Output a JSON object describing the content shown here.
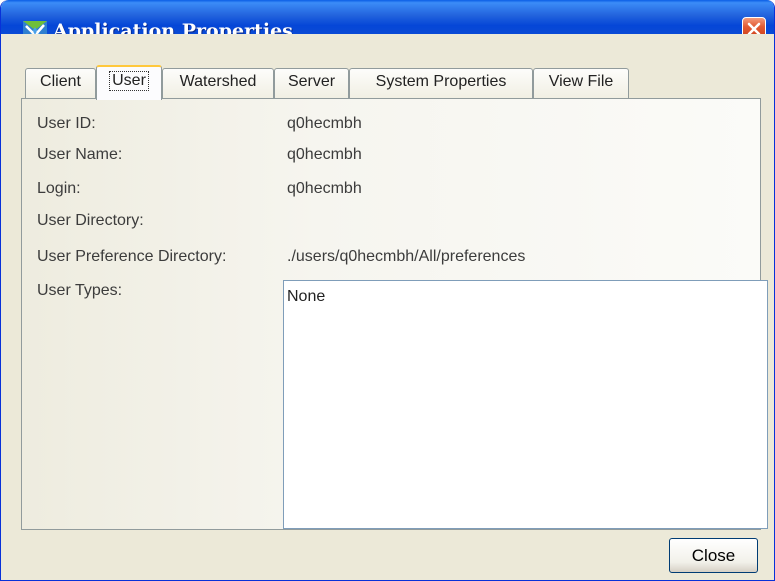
{
  "window": {
    "title": "Application Properties"
  },
  "tabs": [
    {
      "label": "Client"
    },
    {
      "label": "User"
    },
    {
      "label": "Watershed"
    },
    {
      "label": "Server"
    },
    {
      "label": "System Properties"
    },
    {
      "label": "View File"
    }
  ],
  "user": {
    "id_label": "User ID:",
    "id_value": "q0hecmbh",
    "name_label": "User Name:",
    "name_value": "q0hecmbh",
    "login_label": "Login:",
    "login_value": "q0hecmbh",
    "directory_label": "User Directory:",
    "directory_value": "",
    "pref_dir_label": "User Preference Directory:",
    "pref_dir_value": "./users/q0hecmbh/All/preferences",
    "types_label": "User Types:",
    "types_value": "None"
  },
  "buttons": {
    "close_label": "Close"
  },
  "colors": {
    "titlebar": "#0a4bd6",
    "dialog_bg": "#ece9d8",
    "close_icon": "#e25a33",
    "active_tab_highlight": "#ffc83c"
  }
}
